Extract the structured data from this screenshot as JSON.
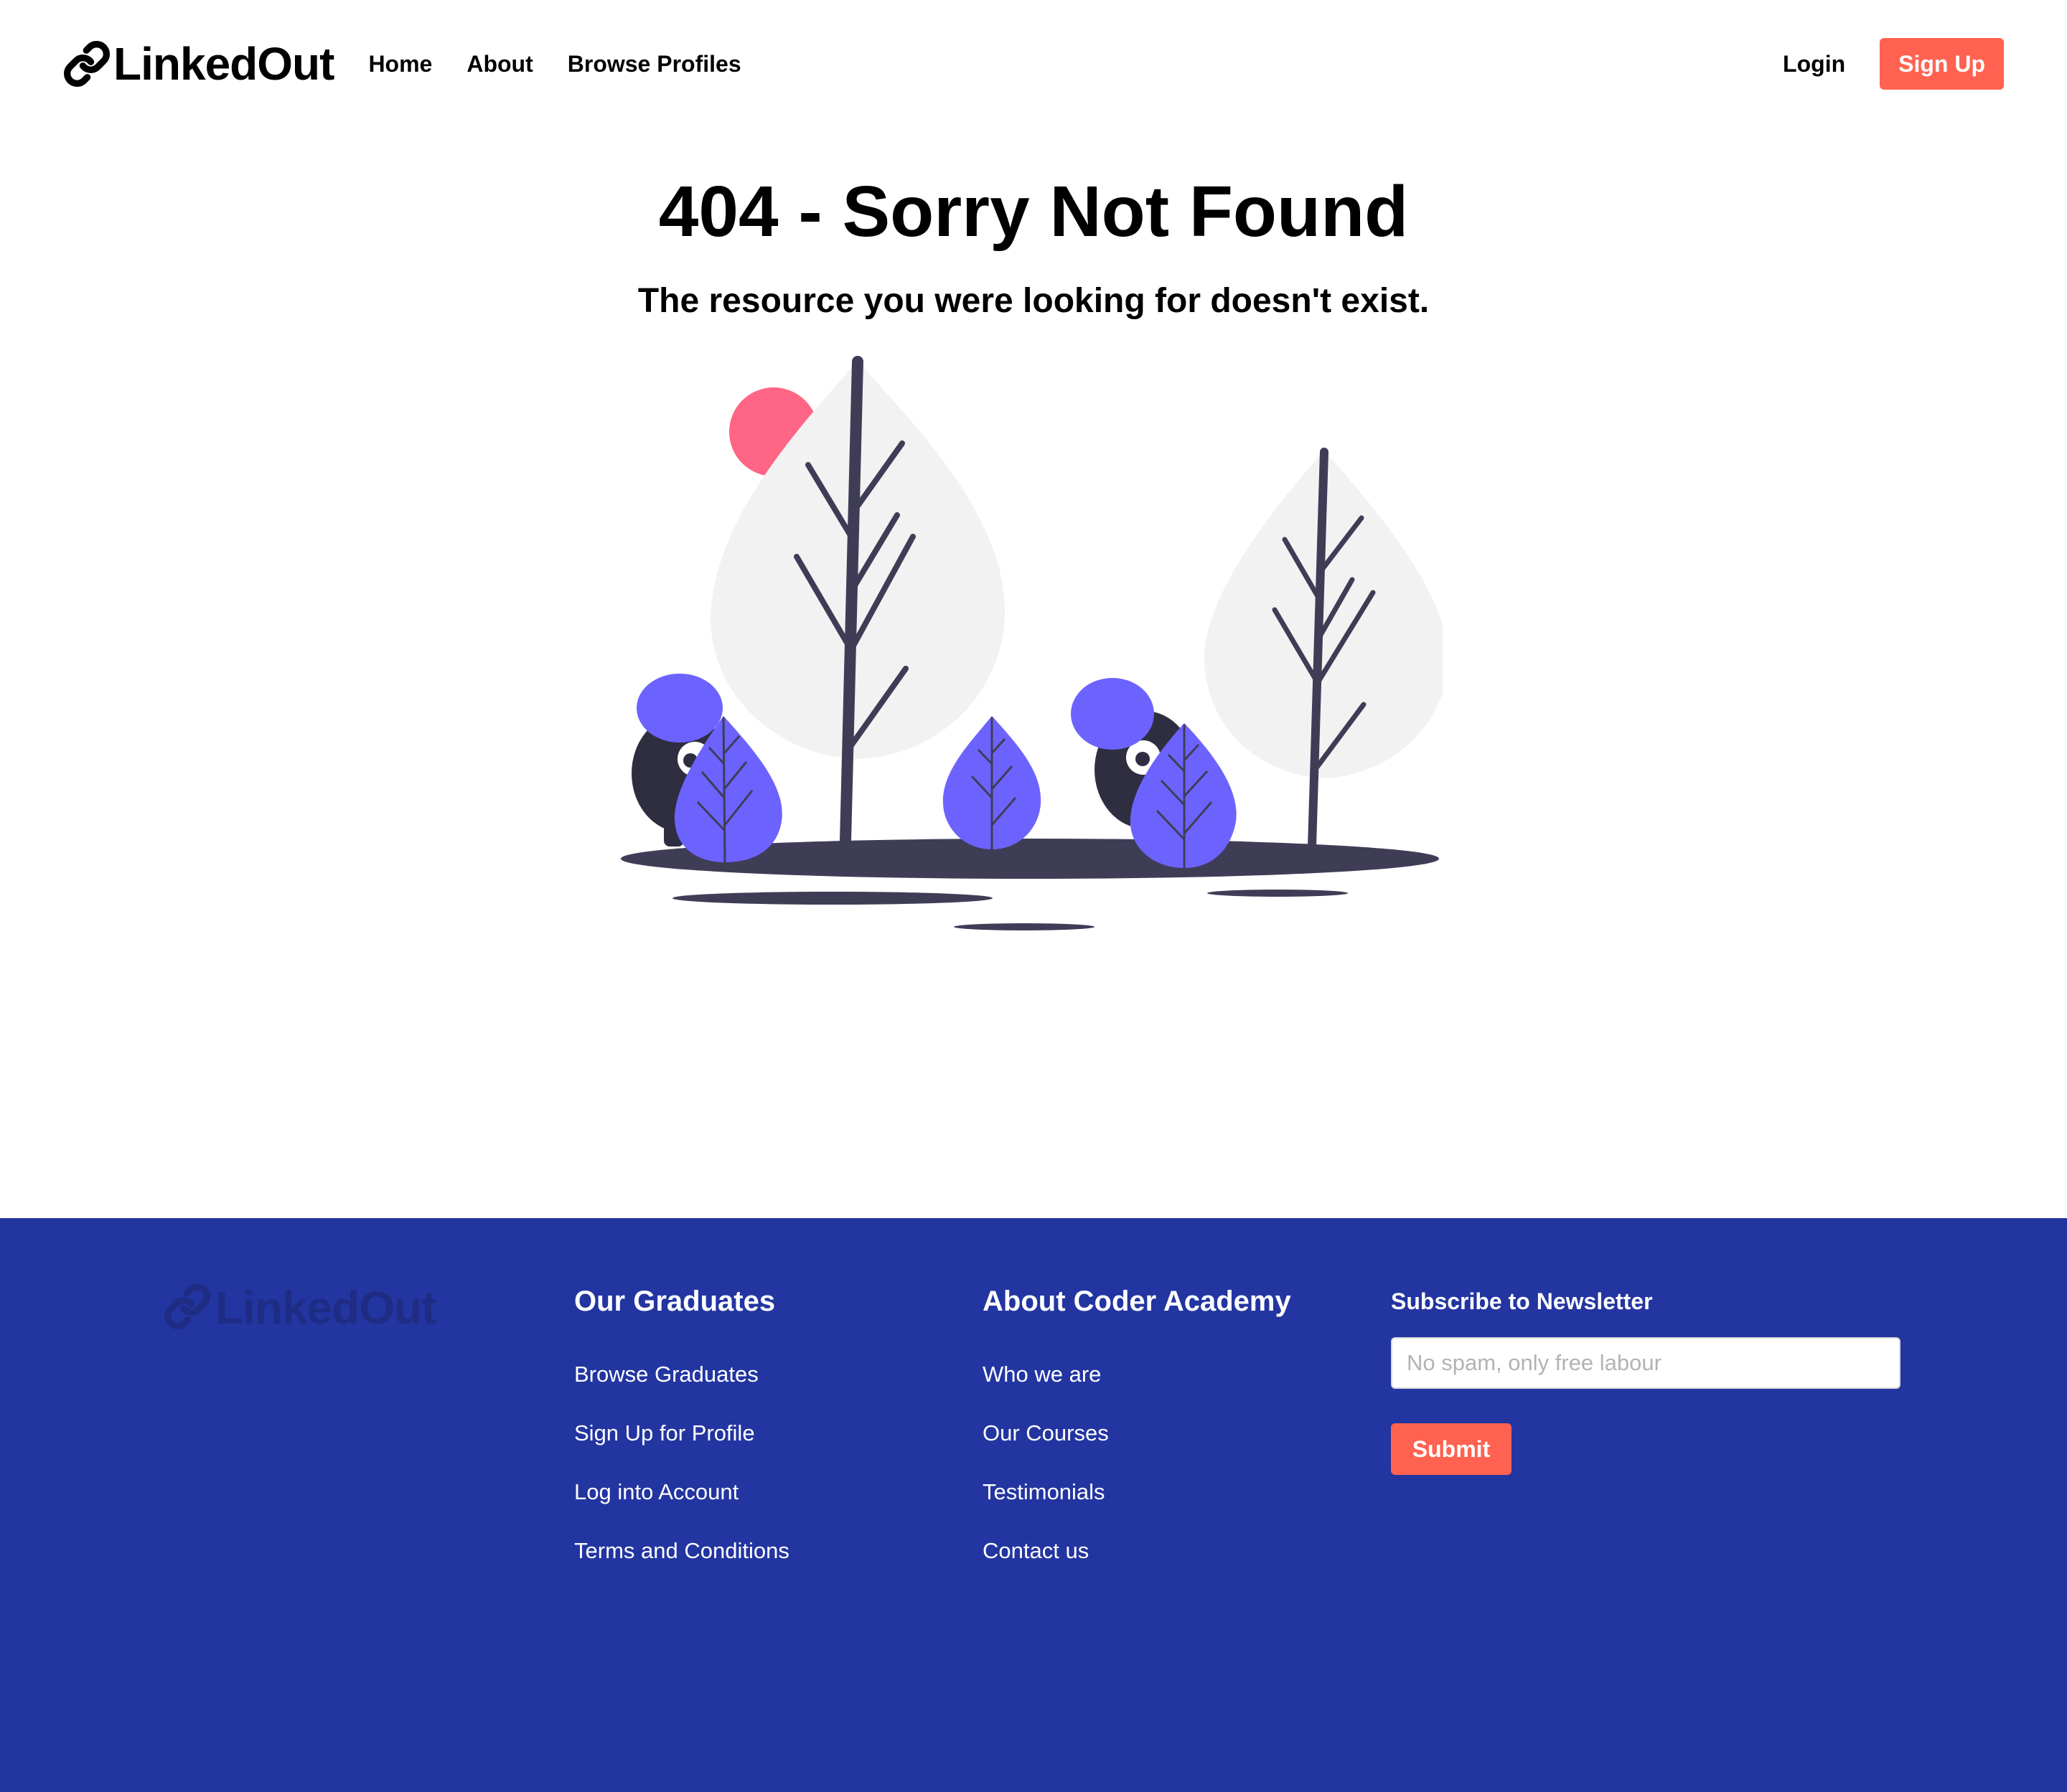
{
  "brand": {
    "name": "LinkedOut",
    "icon": "link-icon"
  },
  "nav": {
    "links": [
      "Home",
      "About",
      "Browse Profiles"
    ],
    "login": "Login",
    "signup": "Sign Up"
  },
  "hero": {
    "title": "404 - Sorry Not Found",
    "subtitle": "The resource you were looking for doesn't exist."
  },
  "footer": {
    "logo_text": "LinkedOut",
    "graduates": {
      "heading": "Our Graduates",
      "links": [
        "Browse Graduates",
        "Sign Up for Profile",
        "Log into Account",
        "Terms and Conditions"
      ]
    },
    "coder_academy": {
      "heading": "About Coder Academy",
      "links": [
        "Who we are",
        "Our Courses",
        "Testimonials",
        "Contact us"
      ]
    },
    "newsletter": {
      "heading": "Subscribe to Newsletter",
      "placeholder": "No spam, only free labour",
      "value": "",
      "submit": "Submit"
    }
  },
  "colors": {
    "accent": "#FF6250",
    "footer_bg": "#2335A1",
    "footer_logo": "#1F2C84",
    "illustration_purple": "#6C63FF",
    "illustration_dark": "#3F3D56",
    "illustration_sun": "#FF6584",
    "illustration_tree": "#F2F2F2"
  }
}
